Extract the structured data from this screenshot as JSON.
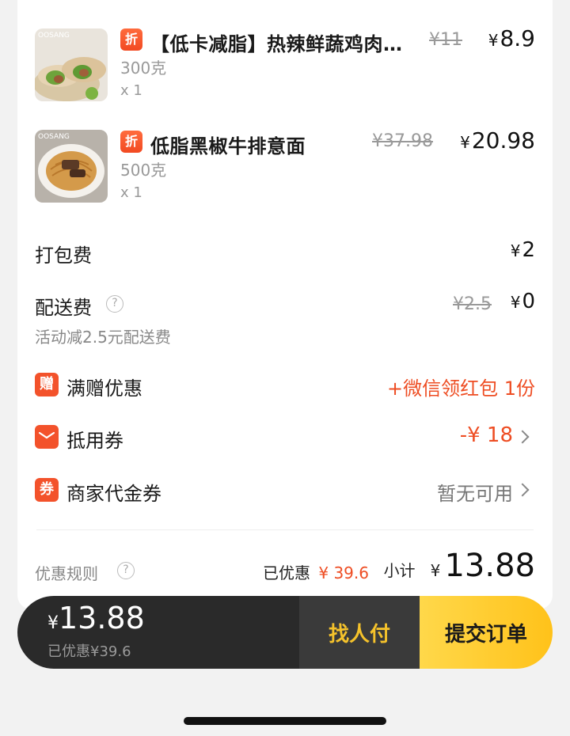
{
  "items": [
    {
      "tag": "折",
      "name": "【低卡减脂】热辣鲜蔬鸡肉…",
      "spec": "300克",
      "qty": "x 1",
      "original_price": "¥11",
      "price_symbol": "¥",
      "price": "8.9",
      "image_brand": "OOSANG"
    },
    {
      "tag": "折",
      "name": "低脂黑椒牛排意面",
      "spec": "500克",
      "qty": "x 1",
      "original_price": "¥37.98",
      "price_symbol": "¥",
      "price": "20.98",
      "image_brand": "OOSANG"
    }
  ],
  "fees": {
    "packing": {
      "label": "打包费",
      "symbol": "¥",
      "value": "2"
    },
    "delivery": {
      "label": "配送费",
      "help": "?",
      "original": "¥2.5",
      "symbol": "¥",
      "value": "0",
      "note": "活动减2.5元配送费"
    }
  },
  "promos": [
    {
      "icon_text": "赠",
      "label": "满赠优惠",
      "value": "+微信领红包 1份"
    },
    {
      "icon_text": "",
      "label": "抵用券",
      "value": "-¥ 18"
    },
    {
      "icon_text": "券",
      "label": "商家代金券",
      "value": "暂无可用"
    }
  ],
  "summary": {
    "rules_label": "优惠规则",
    "help": "?",
    "discount_label": "已优惠",
    "discount_value": "¥ 39.6",
    "subtotal_label": "小计",
    "subtotal_symbol": "¥",
    "subtotal_value": "13.88"
  },
  "checkout": {
    "symbol": "¥",
    "total": "13.88",
    "saved": "已优惠¥39.6",
    "find_payer": "找人付",
    "submit": "提交订单"
  },
  "colors": {
    "accent_red": "#ee4d23",
    "bar_dark": "#2a2a2a",
    "submit_yellow": "#ffc21a",
    "find_payer_text": "#f5c22b"
  }
}
